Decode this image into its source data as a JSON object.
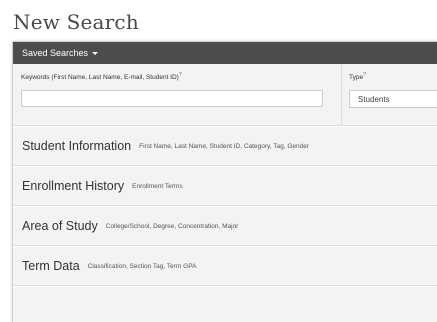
{
  "page_title": "New Search",
  "toolbar": {
    "saved_searches_label": "Saved Searches"
  },
  "fields": {
    "keywords": {
      "label": "Keywords (First Name, Last Name, E-mail, Student ID)",
      "help_marker": "?",
      "value": "",
      "placeholder": ""
    },
    "type": {
      "label": "Type",
      "help_marker": "?",
      "selected": "Students"
    }
  },
  "sections": [
    {
      "title": "Student Information",
      "description": "First Name, Last Name, Student ID, Category, Tag, Gender"
    },
    {
      "title": "Enrollment History",
      "description": "Enrollment Terms"
    },
    {
      "title": "Area of Study",
      "description": "College/School, Degree, Concentration, Major"
    },
    {
      "title": "Term Data",
      "description": "Classification, Section Tag, Term GPA"
    },
    {
      "title": "",
      "description": ""
    }
  ],
  "colors": {
    "toolbar_bg": "#4d4d4d",
    "panel_bg": "#f3f3f3"
  }
}
